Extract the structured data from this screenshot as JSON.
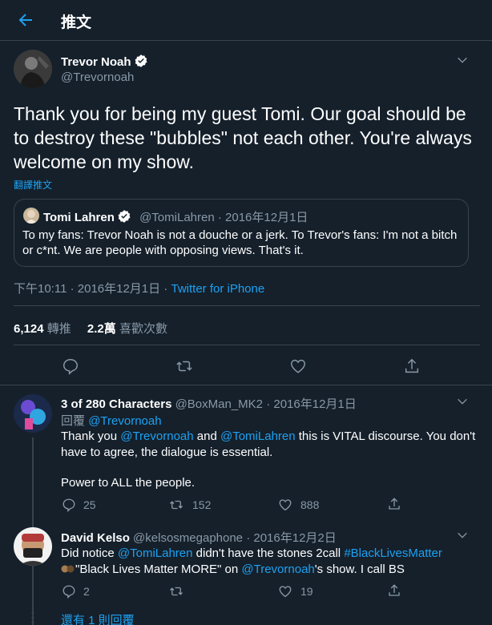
{
  "header": {
    "title": "推文"
  },
  "main_tweet": {
    "author_name": "Trevor Noah",
    "author_handle": "@Trevornoah",
    "text": "Thank you for being my guest Tomi. Our goal should be to destroy these \"bubbles\" not each other. You're always welcome on my show.",
    "translate_label": "翻譯推文",
    "quoted": {
      "author_name": "Tomi Lahren",
      "author_handle": "@TomiLahren",
      "date": "· 2016年12月1日",
      "text": "To my fans: Trevor Noah is not a douche or a jerk. To Trevor's fans: I'm not a bitch or c*nt. We are people with opposing views. That's it."
    },
    "timestamp": "下午10:11 · 2016年12月1日 · ",
    "source": "Twitter for iPhone",
    "retweets_count": "6,124",
    "retweets_label": "轉推",
    "likes_count": "2.2萬",
    "likes_label": "喜歡次數"
  },
  "replies": [
    {
      "author_name": "3 of 280 Characters",
      "author_handle": "@BoxMan_MK2",
      "date": "· 2016年12月1日",
      "replying_label": "回覆",
      "replying_to": "@Trevornoah",
      "text_1": "Thank you ",
      "mention_1": "@Trevornoah",
      "text_2": " and ",
      "mention_2": "@TomiLahren",
      "text_3": " this is VITAL discourse. You don't have to agree, the dialogue is essential.",
      "text_4": "Power to ALL the people.",
      "reply_count": "25",
      "retweet_count": "152",
      "like_count": "888"
    },
    {
      "author_name": "David Kelso",
      "author_handle": "@kelsosmegaphone",
      "date": "· 2016年12月2日",
      "text_1": "Did notice ",
      "mention_1": "@TomiLahren",
      "text_2": " didn't have the stones 2call ",
      "hashtag": "#BlackLivesMatter",
      "text_3": "\"Black Lives Matter MORE\" on ",
      "mention_2": "@Trevornoah",
      "text_4": "'s show. I call BS",
      "reply_count": "2",
      "retweet_count": "",
      "like_count": "19"
    }
  ],
  "more_replies": "還有 1 則回覆",
  "colors": {
    "background": "#15202b",
    "accent": "#1da1f2",
    "secondary_text": "#8899a6",
    "border": "#38444d"
  }
}
